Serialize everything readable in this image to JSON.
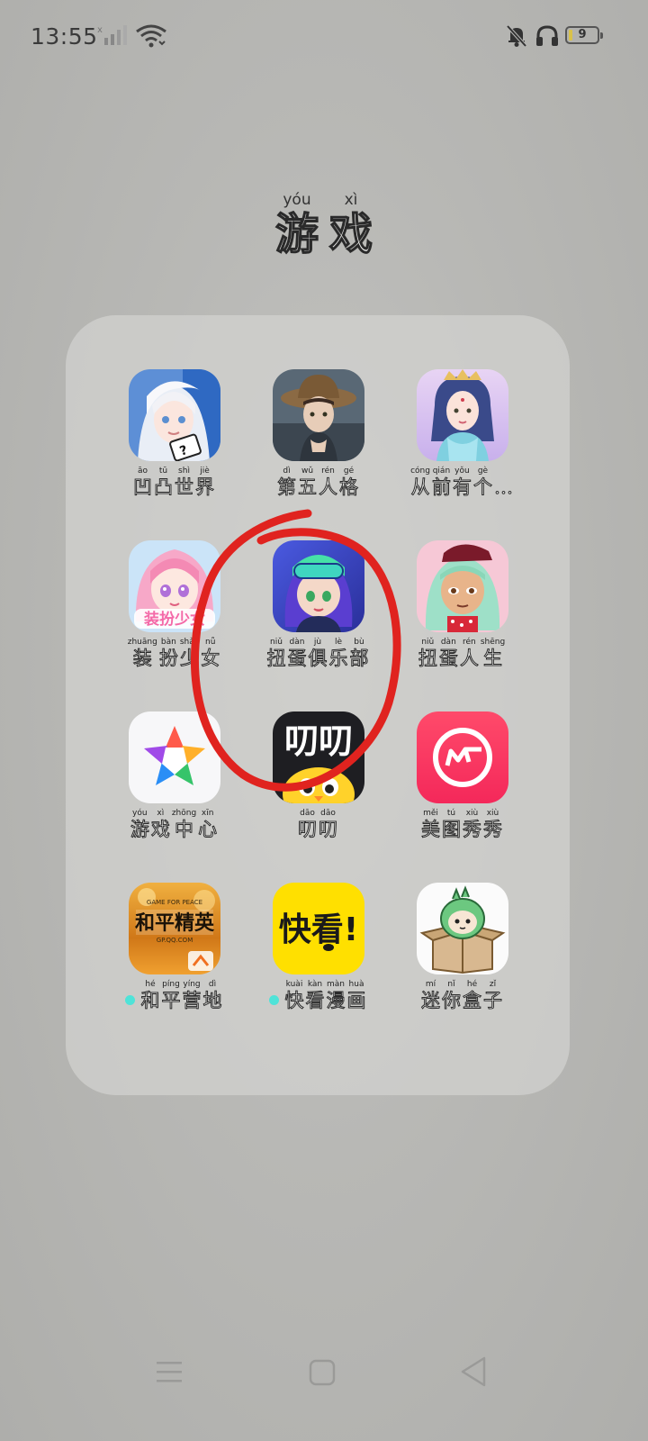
{
  "status_bar": {
    "time": "13:55",
    "battery_level": "9",
    "icons": [
      "signal-icon",
      "wifi-icon",
      "mute-icon",
      "headphone-icon",
      "battery-icon"
    ]
  },
  "folder": {
    "title": [
      {
        "hz": "游",
        "py": "yóu"
      },
      {
        "hz": "戏",
        "py": "xì"
      }
    ],
    "apps": [
      {
        "id": "aotu-shijie",
        "chars": [
          {
            "hz": "凹",
            "py": "āo"
          },
          {
            "hz": "凸",
            "py": "tū"
          },
          {
            "hz": "世",
            "py": "shì"
          },
          {
            "hz": "界",
            "py": "jiè"
          }
        ],
        "dot": false
      },
      {
        "id": "diwu-renge",
        "chars": [
          {
            "hz": "第",
            "py": "dì"
          },
          {
            "hz": "五",
            "py": "wǔ"
          },
          {
            "hz": "人",
            "py": "rén"
          },
          {
            "hz": "格",
            "py": "gé"
          }
        ],
        "dot": false
      },
      {
        "id": "congqian-yougege",
        "chars": [
          {
            "hz": "从",
            "py": "cóng"
          },
          {
            "hz": "前",
            "py": "qián"
          },
          {
            "hz": "有",
            "py": "yǒu"
          },
          {
            "hz": "个",
            "py": "gè"
          }
        ],
        "ellipsis": "…",
        "dot": false
      },
      {
        "id": "zhuangban-shaonv",
        "chars": [
          {
            "hz": "装",
            "py": "zhuāng"
          },
          {
            "hz": "扮",
            "py": "bàn"
          },
          {
            "hz": "少",
            "py": "shǎo"
          },
          {
            "hz": "女",
            "py": "nǚ"
          }
        ],
        "dot": false
      },
      {
        "id": "niudan-julebu",
        "chars": [
          {
            "hz": "扭",
            "py": "niǔ"
          },
          {
            "hz": "蛋",
            "py": "dàn"
          },
          {
            "hz": "俱",
            "py": "jù"
          },
          {
            "hz": "乐",
            "py": "lè"
          },
          {
            "hz": "部",
            "py": "bù"
          }
        ],
        "dot": false
      },
      {
        "id": "niudan-rensheng",
        "chars": [
          {
            "hz": "扭",
            "py": "niǔ"
          },
          {
            "hz": "蛋",
            "py": "dàn"
          },
          {
            "hz": "人",
            "py": "rén"
          },
          {
            "hz": "生",
            "py": "shēng"
          }
        ],
        "dot": false
      },
      {
        "id": "youxi-zhongxin",
        "chars": [
          {
            "hz": "游",
            "py": "yóu"
          },
          {
            "hz": "戏",
            "py": "xì"
          },
          {
            "hz": "中",
            "py": "zhōng"
          },
          {
            "hz": "心",
            "py": "xīn"
          }
        ],
        "dot": false
      },
      {
        "id": "daodao",
        "chars": [
          {
            "hz": "叨",
            "py": "dāo"
          },
          {
            "hz": "叨",
            "py": "dāo"
          }
        ],
        "dot": false
      },
      {
        "id": "meitu-xiuxiu",
        "chars": [
          {
            "hz": "美",
            "py": "měi"
          },
          {
            "hz": "图",
            "py": "tú"
          },
          {
            "hz": "秀",
            "py": "xiù"
          },
          {
            "hz": "秀",
            "py": "xiù"
          }
        ],
        "dot": false
      },
      {
        "id": "heping-yingdi",
        "chars": [
          {
            "hz": "和",
            "py": "hé"
          },
          {
            "hz": "平",
            "py": "píng"
          },
          {
            "hz": "营",
            "py": "yíng"
          },
          {
            "hz": "地",
            "py": "dì"
          }
        ],
        "dot": true
      },
      {
        "id": "kuaikan-manhua",
        "chars": [
          {
            "hz": "快",
            "py": "kuài"
          },
          {
            "hz": "看",
            "py": "kàn"
          },
          {
            "hz": "漫",
            "py": "màn"
          },
          {
            "hz": "画",
            "py": "huà"
          }
        ],
        "dot": true
      },
      {
        "id": "mini-hezi",
        "chars": [
          {
            "hz": "迷",
            "py": "mí"
          },
          {
            "hz": "你",
            "py": "nǐ"
          },
          {
            "hz": "盒",
            "py": "hé"
          },
          {
            "hz": "子",
            "py": "zǐ"
          }
        ],
        "dot": false
      }
    ],
    "icon_text": {
      "heping_banner": "GAME FOR PEACE",
      "heping_logo": "和平精英",
      "heping_url": "GP.QQ.COM",
      "kuaikan_logo": "快看!",
      "daodao_logo": "叨叨",
      "zhuangban_logo": "装扮少女"
    }
  },
  "annotation": {
    "shape": "red-circle",
    "color": "#e0231f",
    "target": "niudan-julebu"
  },
  "nav_bar": {
    "buttons": [
      "menu-icon",
      "home-icon",
      "back-icon"
    ]
  }
}
